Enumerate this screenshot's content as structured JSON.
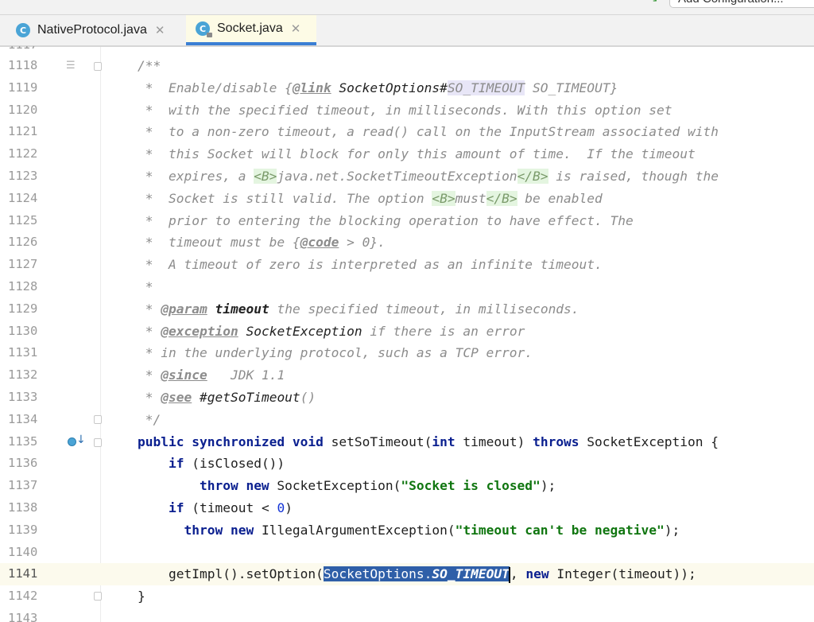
{
  "toolbar": {
    "run_config_label": "Add Configuration..."
  },
  "tabs": [
    {
      "label": "NativeProtocol.java",
      "icon": "class-icon",
      "icon_letter": "C",
      "active": false
    },
    {
      "label": "Socket.java",
      "icon": "class-icon",
      "icon_letter": "C",
      "active": true
    }
  ],
  "editor": {
    "partial_top_line": "1117",
    "partial_bottom_line": "1143",
    "current_line": "1141",
    "lines": [
      {
        "n": "1118",
        "segs": [
          [
            "cm",
            "/**"
          ]
        ]
      },
      {
        "n": "1119",
        "segs": [
          [
            "cm",
            " *  Enable/disable {"
          ],
          [
            "tag",
            "@link"
          ],
          [
            "tagname",
            " SocketOptions#"
          ],
          [
            "ref-hl",
            "SO_TIMEOUT"
          ],
          [
            "cm",
            " SO_TIMEOUT}"
          ]
        ]
      },
      {
        "n": "1120",
        "segs": [
          [
            "cm",
            " *  with the specified timeout, in milliseconds. With this option set"
          ]
        ]
      },
      {
        "n": "1121",
        "segs": [
          [
            "cm",
            " *  to a non-zero timeout, a read() call on the InputStream associated with"
          ]
        ]
      },
      {
        "n": "1122",
        "segs": [
          [
            "cm",
            " *  this Socket will block for only this amount of time.  If the timeout"
          ]
        ]
      },
      {
        "n": "1123",
        "segs": [
          [
            "cm",
            " *  expires, a "
          ],
          [
            "html",
            "<B>"
          ],
          [
            "cm",
            "java.net.SocketTimeoutException"
          ],
          [
            "html",
            "</B>"
          ],
          [
            "cm",
            " is raised, though the"
          ]
        ]
      },
      {
        "n": "1124",
        "segs": [
          [
            "cm",
            " *  Socket is still valid. The option "
          ],
          [
            "html",
            "<B>"
          ],
          [
            "cm",
            "must"
          ],
          [
            "html",
            "</B>"
          ],
          [
            "cm",
            " be enabled"
          ]
        ]
      },
      {
        "n": "1125",
        "segs": [
          [
            "cm",
            " *  prior to entering the blocking operation to have effect. The"
          ]
        ]
      },
      {
        "n": "1126",
        "segs": [
          [
            "cm",
            " *  timeout must be {"
          ],
          [
            "tag",
            "@code"
          ],
          [
            "cm",
            " > 0}."
          ]
        ]
      },
      {
        "n": "1127",
        "segs": [
          [
            "cm",
            " *  A timeout of zero is interpreted as an infinite timeout."
          ]
        ]
      },
      {
        "n": "1128",
        "segs": [
          [
            "cm",
            " *"
          ]
        ]
      },
      {
        "n": "1129",
        "segs": [
          [
            "cm",
            " * "
          ],
          [
            "tag",
            "@param"
          ],
          [
            "cm",
            " "
          ],
          [
            "tagbold",
            "timeout"
          ],
          [
            "cm",
            " the specified timeout, in milliseconds."
          ]
        ]
      },
      {
        "n": "1130",
        "segs": [
          [
            "cm",
            " * "
          ],
          [
            "tag",
            "@exception"
          ],
          [
            "cm",
            " "
          ],
          [
            "tagname",
            "SocketException"
          ],
          [
            "cm",
            " if there is an error"
          ]
        ]
      },
      {
        "n": "1131",
        "segs": [
          [
            "cm",
            " * in the underlying protocol, such as a TCP error."
          ]
        ]
      },
      {
        "n": "1132",
        "segs": [
          [
            "cm",
            " * "
          ],
          [
            "tag",
            "@since"
          ],
          [
            "cm",
            "   JDK 1.1"
          ]
        ]
      },
      {
        "n": "1133",
        "segs": [
          [
            "cm",
            " * "
          ],
          [
            "tag",
            "@see"
          ],
          [
            "cm",
            " "
          ],
          [
            "tagname",
            "#getSoTimeout"
          ],
          [
            "cm",
            "()"
          ]
        ]
      },
      {
        "n": "1134",
        "segs": [
          [
            "cm",
            " */"
          ]
        ]
      },
      {
        "n": "1135",
        "segs": [
          [
            "kw",
            "public synchronized void"
          ],
          [
            "plain",
            " setSoTimeout("
          ],
          [
            "kw",
            "int"
          ],
          [
            "plain",
            " timeout) "
          ],
          [
            "kw",
            "throws"
          ],
          [
            "plain",
            " SocketException {"
          ]
        ]
      },
      {
        "n": "1136",
        "segs": [
          [
            "plain",
            "    "
          ],
          [
            "kw",
            "if"
          ],
          [
            "plain",
            " (isClosed())"
          ]
        ]
      },
      {
        "n": "1137",
        "segs": [
          [
            "plain",
            "        "
          ],
          [
            "kw",
            "throw new"
          ],
          [
            "plain",
            " SocketException("
          ],
          [
            "str",
            "\"Socket is closed\""
          ],
          [
            "plain",
            ");"
          ]
        ]
      },
      {
        "n": "1138",
        "segs": [
          [
            "plain",
            "    "
          ],
          [
            "kw",
            "if"
          ],
          [
            "plain",
            " (timeout < "
          ],
          [
            "num",
            "0"
          ],
          [
            "plain",
            ")"
          ]
        ]
      },
      {
        "n": "1139",
        "segs": [
          [
            "plain",
            "      "
          ],
          [
            "kw",
            "throw new"
          ],
          [
            "plain",
            " IllegalArgumentException("
          ],
          [
            "str",
            "\"timeout can't be negative\""
          ],
          [
            "plain",
            ");"
          ]
        ]
      },
      {
        "n": "1140",
        "segs": []
      },
      {
        "n": "1141",
        "segs": [
          [
            "plain",
            "    getImpl().setOption("
          ],
          [
            "sel",
            "SocketOptions."
          ],
          [
            "sel-it",
            "SO_TIMEOUT"
          ],
          [
            "caret",
            ""
          ],
          [
            "plain",
            ", "
          ],
          [
            "kw",
            "new"
          ],
          [
            "plain",
            " Integer(timeout));"
          ]
        ]
      },
      {
        "n": "1142",
        "segs": [
          [
            "plain",
            "}"
          ]
        ]
      }
    ]
  }
}
